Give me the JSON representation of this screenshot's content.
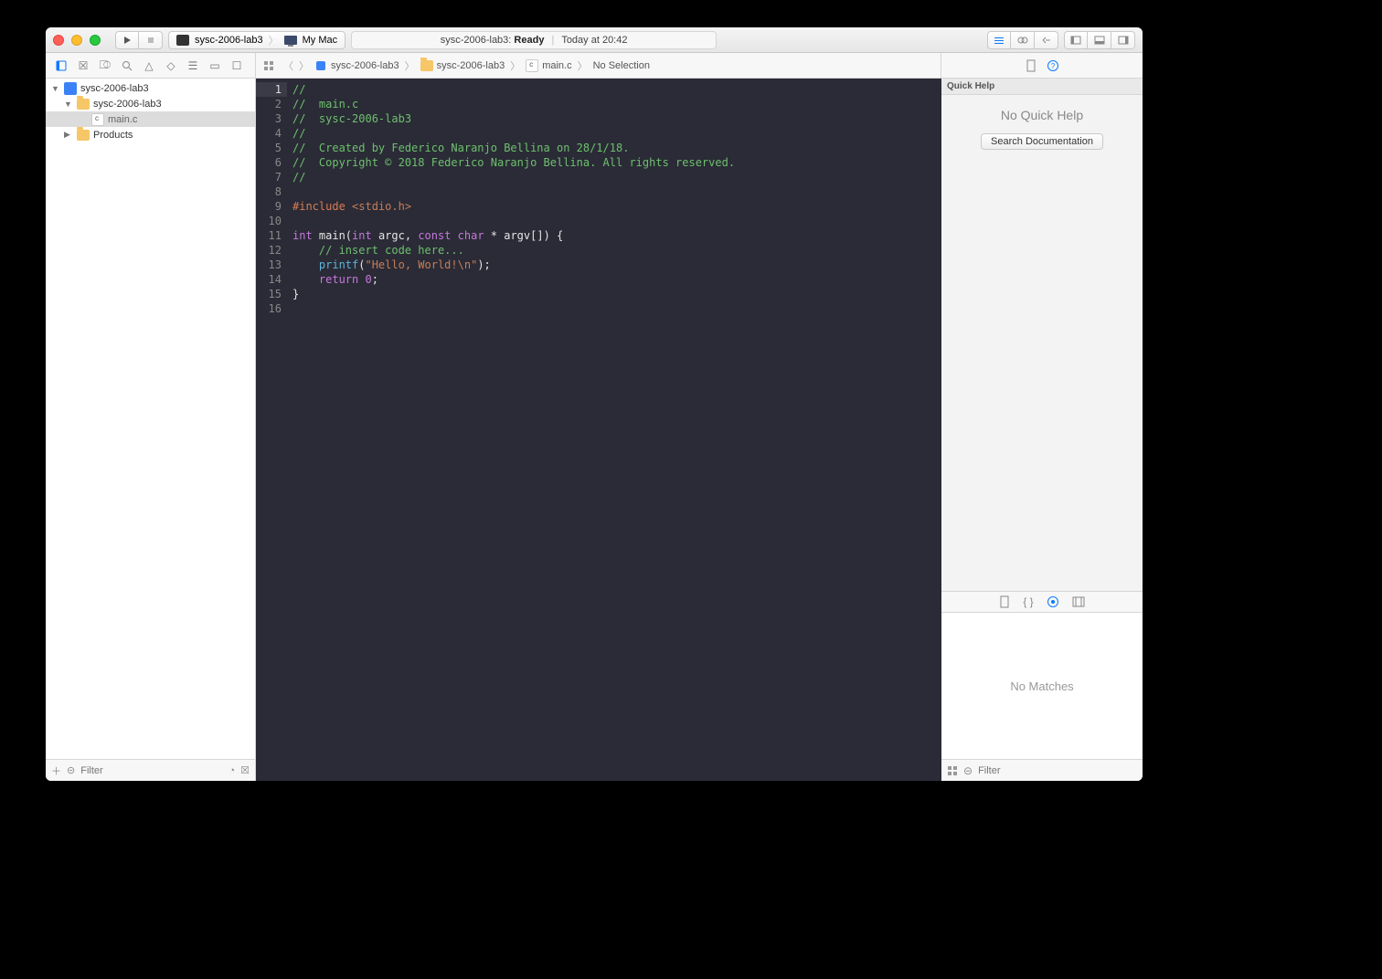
{
  "scheme": {
    "target": "sysc-2006-lab3",
    "device": "My Mac"
  },
  "status": {
    "project": "sysc-2006-lab3",
    "state": "Ready",
    "timestamp": "Today at 20:42"
  },
  "navigator": {
    "root": "sysc-2006-lab3",
    "folder": "sysc-2006-lab3",
    "file": "main.c",
    "products": "Products"
  },
  "sidebar_bottom": {
    "filter_placeholder": "Filter"
  },
  "jumpbar": {
    "crumbs": [
      "sysc-2006-lab3",
      "sysc-2006-lab3",
      "main.c",
      "No Selection"
    ]
  },
  "code": {
    "lines": [
      {
        "n": 1,
        "cur": true
      },
      {
        "n": 2
      },
      {
        "n": 3
      },
      {
        "n": 4
      },
      {
        "n": 5
      },
      {
        "n": 6
      },
      {
        "n": 7
      },
      {
        "n": 8
      },
      {
        "n": 9
      },
      {
        "n": 10
      },
      {
        "n": 11
      },
      {
        "n": 12
      },
      {
        "n": 13
      },
      {
        "n": 14
      },
      {
        "n": 15
      },
      {
        "n": 16
      }
    ],
    "text": {
      "l1": "//",
      "l2": "//  main.c",
      "l3": "//  sysc-2006-lab3",
      "l4": "//",
      "l5": "//  Created by Federico Naranjo Bellina on 28/1/18.",
      "l6": "//  Copyright © 2018 Federico Naranjo Bellina. All rights reserved.",
      "l7": "//",
      "l8": "",
      "l9_pp": "#include ",
      "l9_inc": "<stdio.h>",
      "l10": "",
      "l11_kw_int": "int",
      "l11_main": " main(",
      "l11_kw_int2": "int",
      "l11_argc": " argc, ",
      "l11_kw_const": "const",
      "l11_char": " char",
      "l11_rest": " * argv[]) {",
      "l12": "    // insert code here...",
      "l13_printf": "    printf",
      "l13_open": "(",
      "l13_str": "\"Hello, World!\\n\"",
      "l13_end": ");",
      "l14_ret": "    return ",
      "l14_zero": "0",
      "l14_semi": ";",
      "l15": "}",
      "l16": ""
    }
  },
  "inspector": {
    "quick_help_header": "Quick Help",
    "no_quick_help": "No Quick Help",
    "search_doc": "Search Documentation",
    "no_matches": "No Matches",
    "lib_filter_placeholder": "Filter"
  }
}
